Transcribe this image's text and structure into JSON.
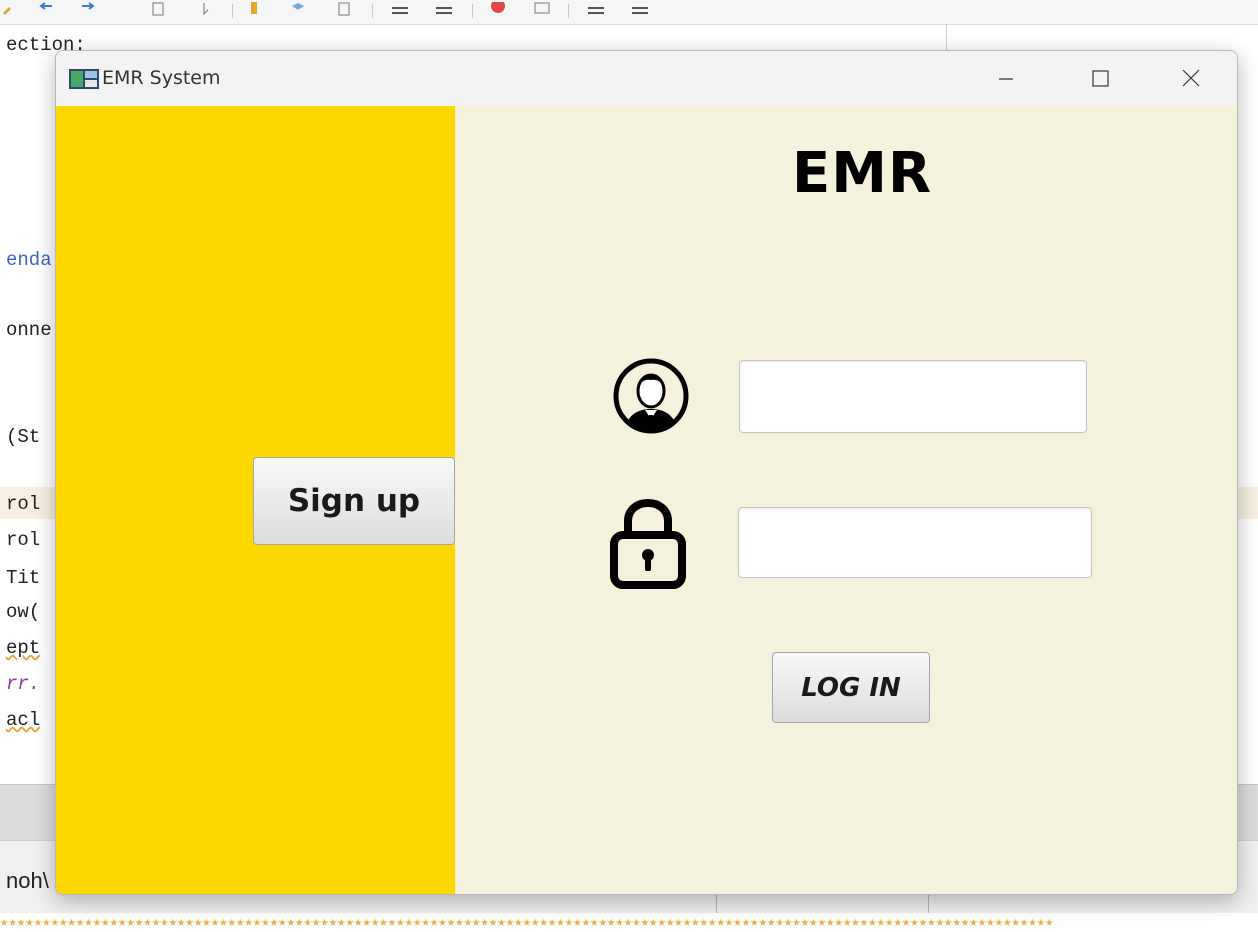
{
  "ide": {
    "code_lines": [
      {
        "text": "ection:",
        "cls": ""
      },
      {
        "text": "enda",
        "cls": "code-blue"
      },
      {
        "text": "onne",
        "cls": ""
      },
      {
        "text": "(St",
        "cls": ""
      },
      {
        "text": "rol",
        "cls": ""
      },
      {
        "text": "rol",
        "cls": ""
      },
      {
        "text": "Tit",
        "cls": ""
      },
      {
        "text": "ow(",
        "cls": ""
      },
      {
        "text": "ept",
        "cls": "squiggle"
      },
      {
        "text": "rr.",
        "cls": "code-purple"
      },
      {
        "text": "acl",
        "cls": "squiggle"
      }
    ],
    "status_text": "noh\\",
    "stars": "★★★★★★★★★★★★★★★★★★★★★★★★★★★★★★★★★★★★★★★★★★★★★★★★★★★★★★★★★★★★★★★★★★★★★★★★★★★★★★★★★★★★★★★★★★★★★★★★★★★★★★★★★★★★★★★★★★★★★★★★★★★★★"
  },
  "window": {
    "title": "EMR System",
    "controls": {
      "minimize": "—",
      "maximize": "☐",
      "close": "✕"
    }
  },
  "login": {
    "heading": "EMR",
    "signup_label": "Sign up",
    "login_label": "LOG IN",
    "username_value": "",
    "password_value": ""
  },
  "icons": {
    "user": "user-avatar-icon",
    "lock": "padlock-icon"
  },
  "colors": {
    "left_pane": "#fed800",
    "right_pane": "#f4f2dd"
  }
}
